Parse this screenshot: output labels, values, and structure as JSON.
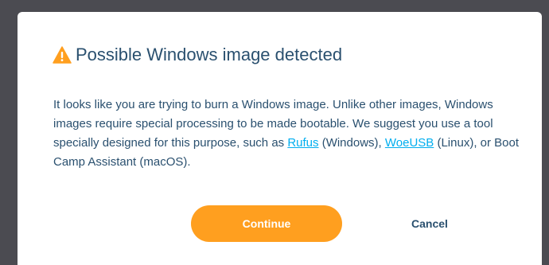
{
  "dialog": {
    "title": "Possible Windows image detected",
    "icon": "warning-triangle-icon",
    "message": {
      "part1": "It looks like you are trying to burn a Windows image. Unlike other images, Windows images require special processing to be made bootable. We suggest you use a tool specially designed for this purpose, such as ",
      "link1": "Rufus",
      "part2": " (Windows), ",
      "link2": "WoeUSB",
      "part3": " (Linux), or Boot Camp Assistant (macOS)."
    },
    "continue_label": "Continue",
    "cancel_label": "Cancel"
  },
  "colors": {
    "backdrop": "#4b4b51",
    "text": "#2a506f",
    "link": "#00aeef",
    "accent": "#ff9f1f",
    "warning": "#ff9f1f"
  }
}
